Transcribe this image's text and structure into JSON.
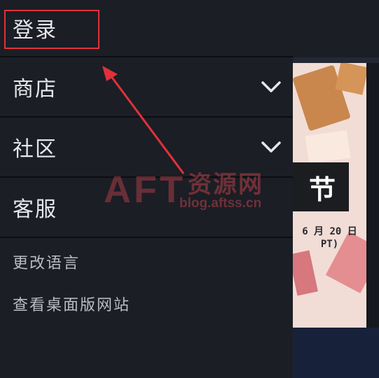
{
  "menu": {
    "login": "登录",
    "store": "商店",
    "community": "社区",
    "support": "客服",
    "change_language": "更改语言",
    "desktop_site": "查看桌面版网站"
  },
  "icons": {
    "store_expand": "chevron-down-icon",
    "community_expand": "chevron-down-icon"
  },
  "background_page": {
    "banner_text": "节",
    "banner_date": "6 月 20 日",
    "banner_sub": "PT)"
  },
  "watermark": {
    "brand": "AFT",
    "name": "资源网",
    "url": "blog.aftss.cn"
  },
  "annotation": {
    "highlight_color": "#e0313b"
  }
}
